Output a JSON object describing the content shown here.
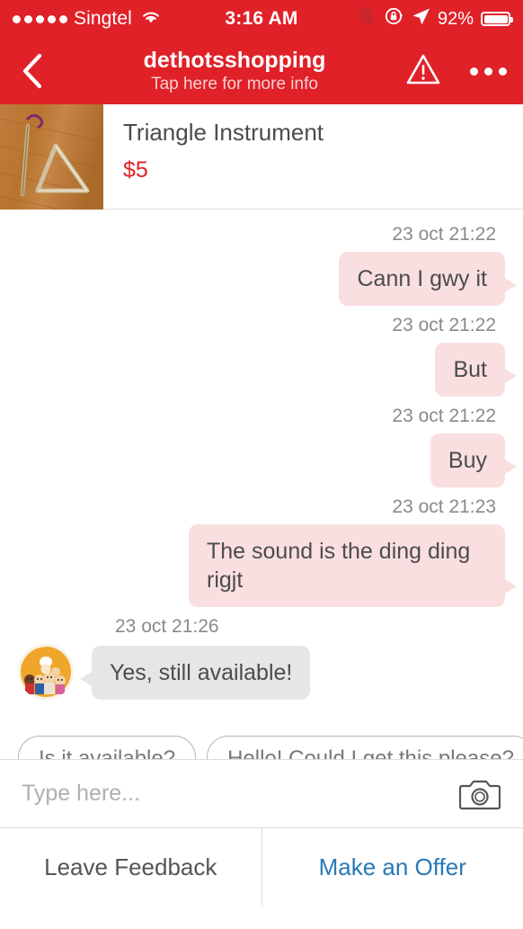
{
  "status_bar": {
    "signal_dots": 5,
    "carrier": "Singtel",
    "wifi_icon": "wifi-icon",
    "time": "3:16 AM",
    "dnd_icon": "moon-icon",
    "rotation_lock_icon": "rotation-lock-icon",
    "location_icon": "location-arrow-icon",
    "battery_percent": "92%",
    "battery_icon": "battery-icon"
  },
  "nav": {
    "back_icon": "chevron-left-icon",
    "title": "dethotsshopping",
    "subtitle": "Tap here for more info",
    "warning_icon": "warning-triangle-icon",
    "more_icon": "ellipsis-icon"
  },
  "product": {
    "image_alt": "triangle-instrument-photo",
    "title": "Triangle Instrument",
    "price": "$5"
  },
  "chat": {
    "messages": [
      {
        "timestamp": "23 oct 21:22",
        "text": "Cann I gwy it",
        "direction": "out"
      },
      {
        "timestamp": "23 oct 21:22",
        "text": "But",
        "direction": "out"
      },
      {
        "timestamp": "23 oct 21:22",
        "text": "Buy",
        "direction": "out"
      },
      {
        "timestamp": "23 oct 21:23",
        "text": "The sound is the ding ding rigjt",
        "direction": "out"
      },
      {
        "timestamp": "23 oct 21:26",
        "text": "Yes, still available!",
        "direction": "in",
        "avatar": "seller-avatar"
      }
    ],
    "suggestions": [
      "Is it available?",
      "Hello! Could I get this please?"
    ]
  },
  "input": {
    "placeholder": "Type here...",
    "camera_icon": "camera-icon"
  },
  "actions": {
    "leave_feedback": "Leave Feedback",
    "make_offer": "Make an Offer"
  },
  "colors": {
    "brand_red": "#e02128",
    "outgoing_bubble": "#fadfe0",
    "incoming_bubble": "#e6e6e6",
    "offer_blue": "#2879b9",
    "price_red": "#e02128"
  }
}
